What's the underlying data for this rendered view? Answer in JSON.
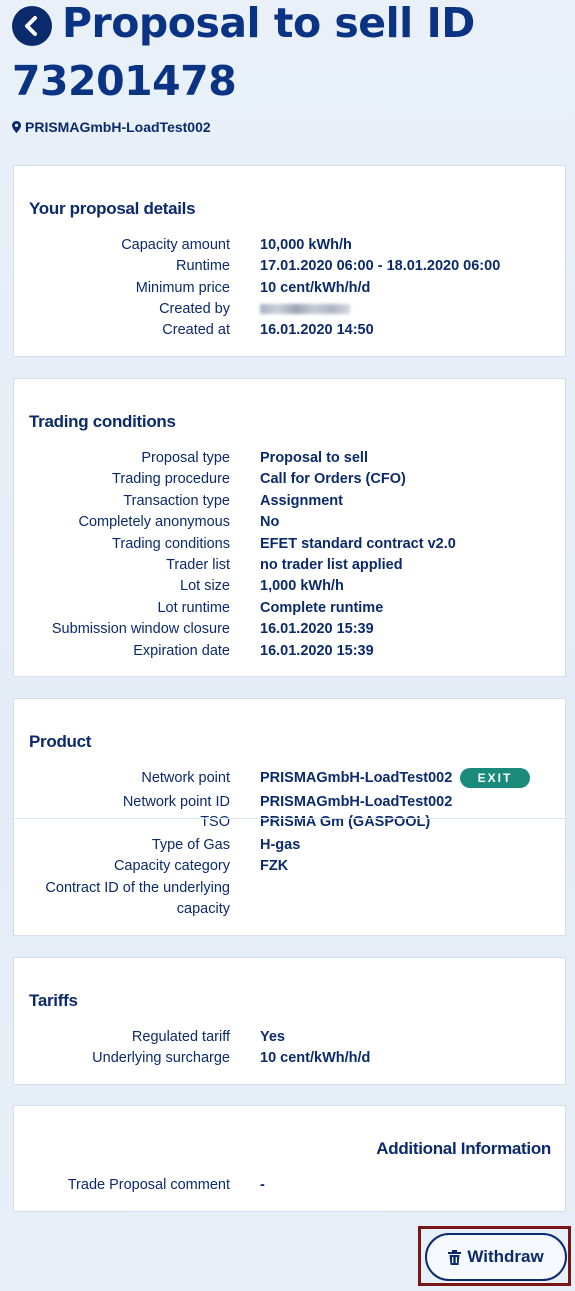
{
  "header": {
    "title": "Proposal to sell ID 73201478",
    "location": "PRISMAGmbH-LoadTest002"
  },
  "proposal_details": {
    "heading": "Your proposal details",
    "rows": [
      {
        "label": "Capacity amount",
        "value": "10,000 kWh/h"
      },
      {
        "label": "Runtime",
        "value": "17.01.2020 06:00 - 18.01.2020 06:00"
      },
      {
        "label": "Minimum price",
        "value": "10 cent/kWh/h/d"
      },
      {
        "label": "Created by",
        "value": ""
      },
      {
        "label": "Created at",
        "value": "16.01.2020 14:50"
      }
    ]
  },
  "trading_conditions": {
    "heading": "Trading conditions",
    "rows": [
      {
        "label": "Proposal type",
        "value": "Proposal to sell"
      },
      {
        "label": "Trading procedure",
        "value": "Call for Orders (CFO)"
      },
      {
        "label": "Transaction type",
        "value": "Assignment"
      },
      {
        "label": "Completely anonymous",
        "value": "No"
      },
      {
        "label": "Trading conditions",
        "value": "EFET standard contract v2.0"
      },
      {
        "label": "Trader list",
        "value": "no trader list applied"
      },
      {
        "label": "Lot size",
        "value": "1,000 kWh/h"
      },
      {
        "label": "Lot runtime",
        "value": "Complete runtime"
      },
      {
        "label": "Submission window closure",
        "value": "16.01.2020 15:39"
      },
      {
        "label": "Expiration date",
        "value": "16.01.2020 15:39"
      }
    ]
  },
  "product": {
    "heading": "Product",
    "exit_badge": "EXIT",
    "rows": [
      {
        "label": "Network point",
        "value": "PRISMAGmbH-LoadTest002"
      },
      {
        "label": "Network point ID",
        "value": "PRISMAGmbH-LoadTest002"
      },
      {
        "label": "TSO",
        "value": "PRISMA Gm (GASPOOL)"
      },
      {
        "label": "Type of Gas",
        "value": "H-gas"
      },
      {
        "label": "Capacity category",
        "value": "FZK"
      },
      {
        "label_line1": "Contract ID of the underlying",
        "label_line2": "capacity",
        "value": ""
      }
    ]
  },
  "tariffs": {
    "heading": "Tariffs",
    "rows": [
      {
        "label": "Regulated tariff",
        "value": "Yes"
      },
      {
        "label": "Underlying surcharge",
        "value": "10 cent/kWh/h/d"
      }
    ]
  },
  "additional": {
    "heading": "Additional Information",
    "rows": [
      {
        "label": "Trade Proposal comment",
        "value": "-"
      }
    ]
  },
  "actions": {
    "withdraw_label": "Withdraw"
  },
  "colors": {
    "primary": "#0b2a6b",
    "exit_badge": "#1a8a7a",
    "highlight_frame": "#7b1416"
  }
}
